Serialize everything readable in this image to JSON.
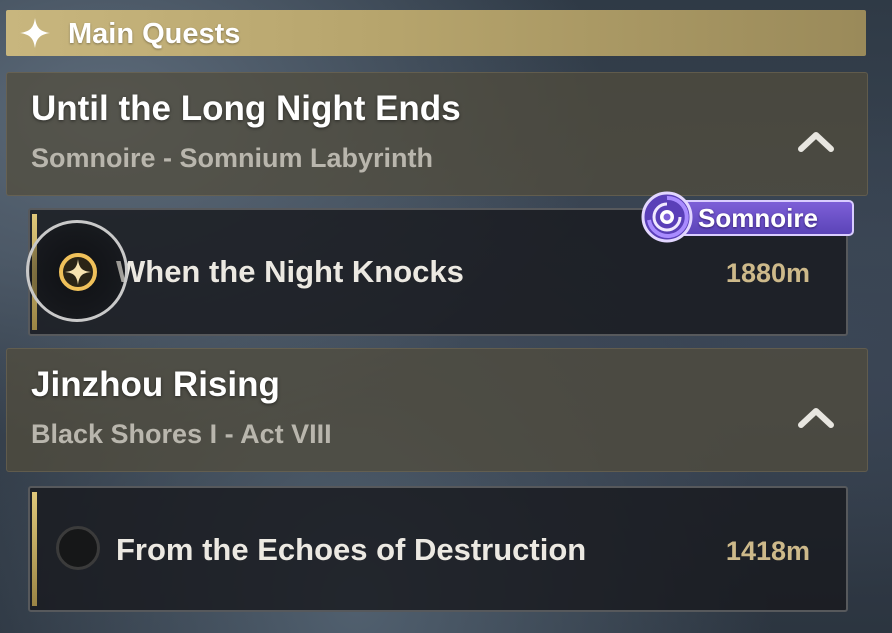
{
  "section": {
    "title": "Main Quests",
    "icon": "star-icon"
  },
  "quests": [
    {
      "title": "Until the Long Night Ends",
      "subtitle": "Somnoire - Somnium Labyrinth",
      "expanded": true,
      "step": {
        "title": "When the Night Knocks",
        "distance": "1880m",
        "tracked": true
      }
    },
    {
      "title": "Jinzhou Rising",
      "subtitle": "Black Shores I - Act VIII",
      "expanded": true,
      "step": {
        "title": "From the Echoes of Destruction",
        "distance": "1418m",
        "tracked": false
      }
    }
  ],
  "badge": {
    "label": "Somnoire",
    "icon": "somnoire-emblem-icon"
  },
  "colors": {
    "header_gold": "#c8b67e",
    "badge_purple": "#6a50c8",
    "distance_gold": "#cdb98a"
  }
}
